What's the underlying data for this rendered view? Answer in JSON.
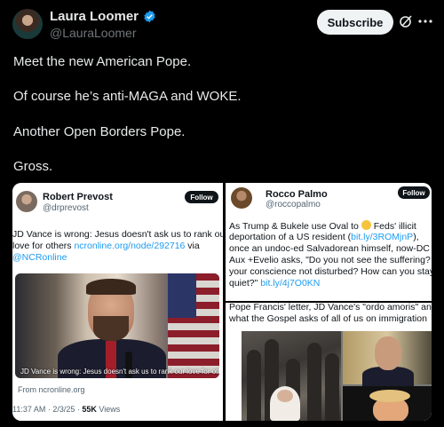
{
  "author": {
    "name": "Laura Loomer",
    "handle": "@LauraLoomer"
  },
  "header": {
    "subscribe_label": "Subscribe"
  },
  "tweet": {
    "lines": [
      "Meet the new American Pope.",
      "Of course he’s anti-MAGA and WOKE.",
      "Another Open Borders Pope.",
      "Gross."
    ]
  },
  "quote_left": {
    "name": "Robert Prevost",
    "handle": "@drprevost",
    "follow_label": "Follow",
    "text_line1": "JD Vance is wrong: Jesus doesn't ask us to rank our",
    "text_line2_a": "love for others ",
    "text_line2_link": "ncronline.org/node/292716",
    "text_line2_b": " via",
    "text_line3_link": "@NCRonline",
    "image_caption": "JD Vance is wrong: Jesus doesn't ask us to rank our love for others",
    "from_label": "From ncronline.org",
    "meta_time": "11:37 AM · 2/3/25 · ",
    "meta_views_count": "55K",
    "meta_views_label": " Views"
  },
  "quote_right": {
    "name": "Rocco Palmo",
    "handle": "@roccopalmo",
    "follow_label": "Follow",
    "line1_a": "As Trump & Bukele use Oval to ",
    "line1_b": " Feds' illicit",
    "line2_a": "deportation of a US resident (",
    "line2_link": "bit.ly/3ROMjnP",
    "line2_b": "),",
    "line3": "once an undoc-ed Salvadorean himself, now-DC",
    "line4": "Aux +Evelio asks, \"Do you not see the suffering? Is",
    "line5": "your conscience not disturbed? How can you stay",
    "line6_a": "quiet?\" ",
    "line6_link": "bit.ly/4j7O0KN",
    "cut_line1": "Pope Francis' letter, JD Vance's \"ordo amoris\" and",
    "cut_line2": "what the Gospel asks of all of us on immigration"
  },
  "colors": {
    "background": "#000000",
    "text": "#e7e9ea",
    "muted": "#71767b",
    "link": "#1d9bf0",
    "verified": "#1d9bf0"
  }
}
